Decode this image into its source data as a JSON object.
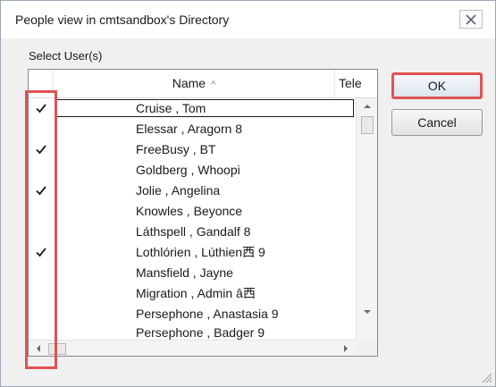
{
  "window": {
    "title": "People view in cmtsandbox's Directory",
    "close_icon": "close-icon"
  },
  "picker": {
    "label": "Select User(s)",
    "columns": {
      "name": "Name",
      "name_sort_indicator": "^",
      "telephone": "Tele"
    },
    "rows": [
      {
        "name": "Cruise , Tom",
        "checked": true,
        "focused": true
      },
      {
        "name": "Elessar , Aragorn 8",
        "checked": false
      },
      {
        "name": "FreeBusy , BT",
        "checked": true
      },
      {
        "name": "Goldberg , Whoopi",
        "checked": false
      },
      {
        "name": "Jolie , Angelina",
        "checked": true
      },
      {
        "name": "Knowles , Beyonce",
        "checked": false
      },
      {
        "name": "Láthspell , Gandalf 8",
        "checked": false
      },
      {
        "name": "Lothlórien , Lúthien西 9",
        "checked": true
      },
      {
        "name": "Mansfield , Jayne",
        "checked": false
      },
      {
        "name": "Migration , Admin â西",
        "checked": false
      },
      {
        "name": "Persephone , Anastasia 9",
        "checked": false
      },
      {
        "name": "Persephone , Badger 9",
        "checked": false
      }
    ]
  },
  "buttons": {
    "ok": "OK",
    "cancel": "Cancel"
  },
  "colors": {
    "highlight": "#e05252"
  }
}
